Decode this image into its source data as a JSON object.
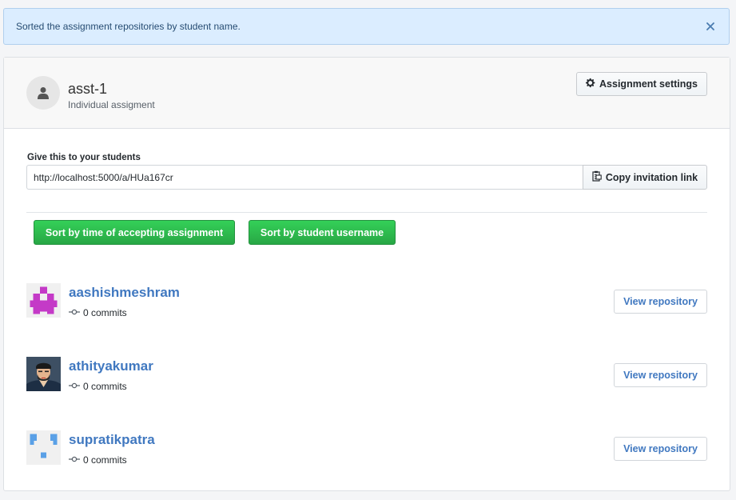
{
  "flash": {
    "message": "Sorted the assignment repositories by student name.",
    "close_icon": "close-icon"
  },
  "assignment": {
    "title": "asst-1",
    "type": "Individual assigment",
    "settings_label": "Assignment settings"
  },
  "invitation": {
    "label": "Give this to your students",
    "url": "http://localhost:5000/a/HUa167cr",
    "copy_label": "Copy invitation link"
  },
  "sort": {
    "by_time_label": "Sort by time of accepting assignment",
    "by_username_label": "Sort by student username"
  },
  "students": [
    {
      "username": "aashishmeshram",
      "commits": "0 commits",
      "view_label": "View repository"
    },
    {
      "username": "athityakumar",
      "commits": "0 commits",
      "view_label": "View repository"
    },
    {
      "username": "supratikpatra",
      "commits": "0 commits",
      "view_label": "View repository"
    }
  ],
  "colors": {
    "link": "#4078c0",
    "green": "#28a745",
    "flash_bg": "#dbedff"
  }
}
